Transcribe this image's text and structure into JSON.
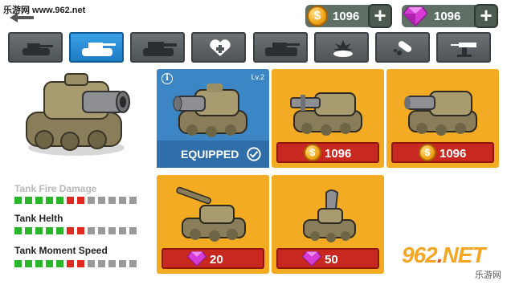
{
  "watermark_top": "乐游网 www.962.net",
  "currency": {
    "coins": "1096",
    "gems": "1096",
    "coin_symbol": "$",
    "add_symbol": "+"
  },
  "tabs": [
    {
      "name": "tab-light-tank",
      "icon": "light-tank-icon",
      "active": false
    },
    {
      "name": "tab-tank",
      "icon": "tank-icon",
      "active": true
    },
    {
      "name": "tab-heavy-tank",
      "icon": "heavy-tank-icon",
      "active": false
    },
    {
      "name": "tab-health",
      "icon": "heart-plus-icon",
      "active": false
    },
    {
      "name": "tab-armored-tank",
      "icon": "armored-tank-icon",
      "active": false
    },
    {
      "name": "tab-mine",
      "icon": "mine-explosion-icon",
      "active": false
    },
    {
      "name": "tab-missile",
      "icon": "missile-icon",
      "active": false
    },
    {
      "name": "tab-turret",
      "icon": "turret-icon",
      "active": false
    }
  ],
  "stats": [
    {
      "label": "Tank Fire Damage",
      "faded": true,
      "level": [
        1,
        1,
        1,
        1,
        1,
        2,
        2,
        0,
        0,
        0,
        0,
        0
      ]
    },
    {
      "label": "Tank Helth",
      "faded": false,
      "level": [
        1,
        1,
        1,
        1,
        1,
        2,
        2,
        0,
        0,
        0,
        0,
        0
      ]
    },
    {
      "label": "Tank Moment Speed",
      "faded": false,
      "level": [
        1,
        1,
        1,
        1,
        1,
        2,
        2,
        0,
        0,
        0,
        0,
        0
      ]
    }
  ],
  "cards": [
    {
      "style": "blue",
      "equipped": true,
      "level": "Lv.2",
      "equipped_label": "EQUIPPED",
      "info": "i"
    },
    {
      "style": "gold",
      "currency": "coin",
      "price": "1096"
    },
    {
      "style": "gold",
      "currency": "coin",
      "price": "1096"
    },
    {
      "style": "gold",
      "currency": "gem",
      "price": "20"
    },
    {
      "style": "gold",
      "currency": "gem",
      "price": "50"
    }
  ],
  "watermark_bottom": {
    "big_prefix": "962",
    "big_dot": ".",
    "big_suffix": "NET",
    "small": "乐游网"
  },
  "colors": {
    "stat_green": "#2bb52b",
    "stat_red": "#e02a1f",
    "stat_gray": "#9a9a9a",
    "card_gold": "#f3ab23",
    "card_blue": "#3d86c6",
    "tab_active": "#1e7cc4",
    "price_red": "#c8281f"
  }
}
